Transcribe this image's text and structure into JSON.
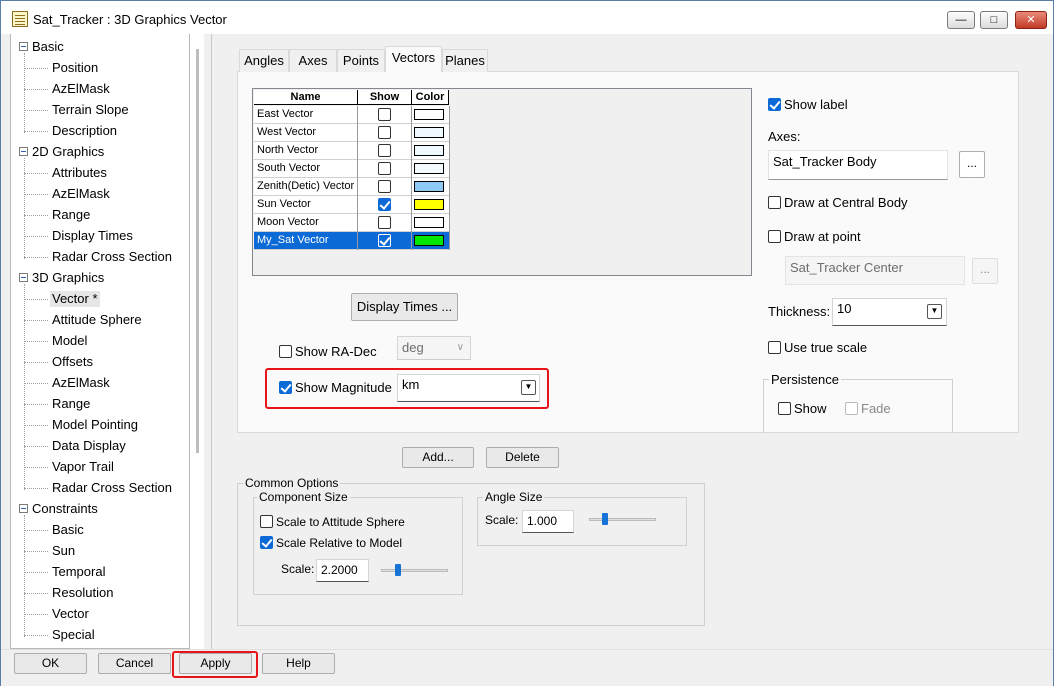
{
  "window": {
    "title": "Sat_Tracker : 3D Graphics Vector"
  },
  "tree": [
    {
      "label": "Basic",
      "level": 0
    },
    {
      "label": "Position",
      "level": 1
    },
    {
      "label": "AzElMask",
      "level": 1
    },
    {
      "label": "Terrain Slope",
      "level": 1
    },
    {
      "label": "Description",
      "level": 1
    },
    {
      "label": "2D Graphics",
      "level": 0
    },
    {
      "label": "Attributes",
      "level": 1
    },
    {
      "label": "AzElMask",
      "level": 1
    },
    {
      "label": "Range",
      "level": 1
    },
    {
      "label": "Display Times",
      "level": 1
    },
    {
      "label": "Radar Cross Section",
      "level": 1
    },
    {
      "label": "3D Graphics",
      "level": 0
    },
    {
      "label": "Vector *",
      "level": 1,
      "selected": true
    },
    {
      "label": "Attitude Sphere",
      "level": 1
    },
    {
      "label": "Model",
      "level": 1
    },
    {
      "label": "Offsets",
      "level": 1
    },
    {
      "label": "AzElMask",
      "level": 1
    },
    {
      "label": "Range",
      "level": 1
    },
    {
      "label": "Model Pointing",
      "level": 1
    },
    {
      "label": "Data Display",
      "level": 1
    },
    {
      "label": "Vapor Trail",
      "level": 1
    },
    {
      "label": "Radar Cross Section",
      "level": 1
    },
    {
      "label": "Constraints",
      "level": 0
    },
    {
      "label": "Basic",
      "level": 1
    },
    {
      "label": "Sun",
      "level": 1
    },
    {
      "label": "Temporal",
      "level": 1
    },
    {
      "label": "Resolution",
      "level": 1
    },
    {
      "label": "Vector",
      "level": 1
    },
    {
      "label": "Special",
      "level": 1
    }
  ],
  "tabs": [
    "Angles",
    "Axes",
    "Points",
    "Vectors",
    "Planes"
  ],
  "active_tab": "Vectors",
  "grid": {
    "headers": [
      "Name",
      "Show",
      "Color"
    ],
    "rows": [
      {
        "name": "East Vector",
        "show": false,
        "color": "#ffffff"
      },
      {
        "name": "West Vector",
        "show": false,
        "color": "#eefaff"
      },
      {
        "name": "North Vector",
        "show": false,
        "color": "#eefaff"
      },
      {
        "name": "South Vector",
        "show": false,
        "color": "#f4fbff"
      },
      {
        "name": "Zenith(Detic) Vector",
        "show": false,
        "color": "#8ec8f4"
      },
      {
        "name": "Sun Vector",
        "show": true,
        "color": "#ffff00"
      },
      {
        "name": "Moon Vector",
        "show": false,
        "color": "#ffffff"
      },
      {
        "name": "My_Sat Vector",
        "show": true,
        "color": "#00e600",
        "selected": true
      }
    ]
  },
  "buttons": {
    "display_times": "Display Times ...",
    "add": "Add...",
    "delete": "Delete",
    "axes_browse": "...",
    "point_browse": "...",
    "ok": "OK",
    "cancel": "Cancel",
    "apply": "Apply",
    "help": "Help"
  },
  "ra_dec": {
    "label": "Show RA-Dec",
    "checked": false,
    "unit": "deg"
  },
  "magnitude": {
    "label": "Show Magnitude",
    "checked": true,
    "unit": "km"
  },
  "right": {
    "show_label": {
      "label": "Show label",
      "checked": true
    },
    "axes_label": "Axes:",
    "axes_value": "Sat_Tracker Body",
    "draw_central": {
      "label": "Draw at Central Body",
      "checked": false
    },
    "draw_point": {
      "label": "Draw at point",
      "checked": false
    },
    "point_value": "Sat_Tracker Center",
    "thickness_label": "Thickness:",
    "thickness_value": "10",
    "true_scale": {
      "label": "Use true scale",
      "checked": false
    },
    "persistence": {
      "title": "Persistence",
      "show": "Show",
      "fade": "Fade"
    }
  },
  "common": {
    "title": "Common Options",
    "component_title": "Component Size",
    "scale_to_sphere": {
      "label": "Scale to Attitude Sphere",
      "checked": false
    },
    "scale_relative": {
      "label": "Scale Relative to Model",
      "checked": true
    },
    "scale_label": "Scale:",
    "scale_value": "2.2000",
    "angle_title": "Angle Size",
    "angle_scale_label": "Scale:",
    "angle_scale_value": "1.000"
  },
  "colors": {
    "accent": "#0b6ad6",
    "highlight": "#e8141a",
    "selection": "#0b6ad6"
  }
}
